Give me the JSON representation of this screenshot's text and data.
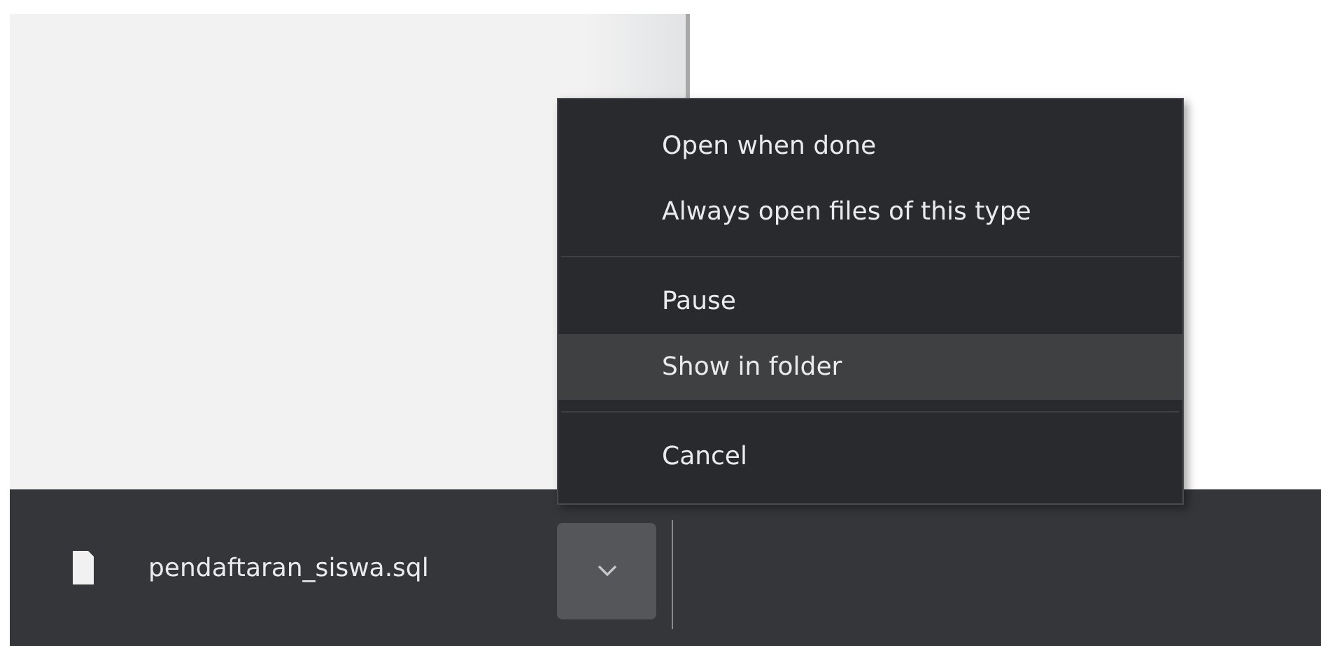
{
  "download_bar": {
    "file_name": "pendaftaran_siswa.sql",
    "menu_open": true
  },
  "context_menu": {
    "items": [
      {
        "kind": "item",
        "label": "Open when done",
        "selected": false
      },
      {
        "kind": "item",
        "label": "Always open files of this type",
        "selected": false
      },
      {
        "kind": "separator"
      },
      {
        "kind": "item",
        "label": "Pause",
        "selected": false
      },
      {
        "kind": "item",
        "label": "Show in folder",
        "selected": true
      },
      {
        "kind": "separator"
      },
      {
        "kind": "item",
        "label": "Cancel",
        "selected": false
      }
    ]
  }
}
